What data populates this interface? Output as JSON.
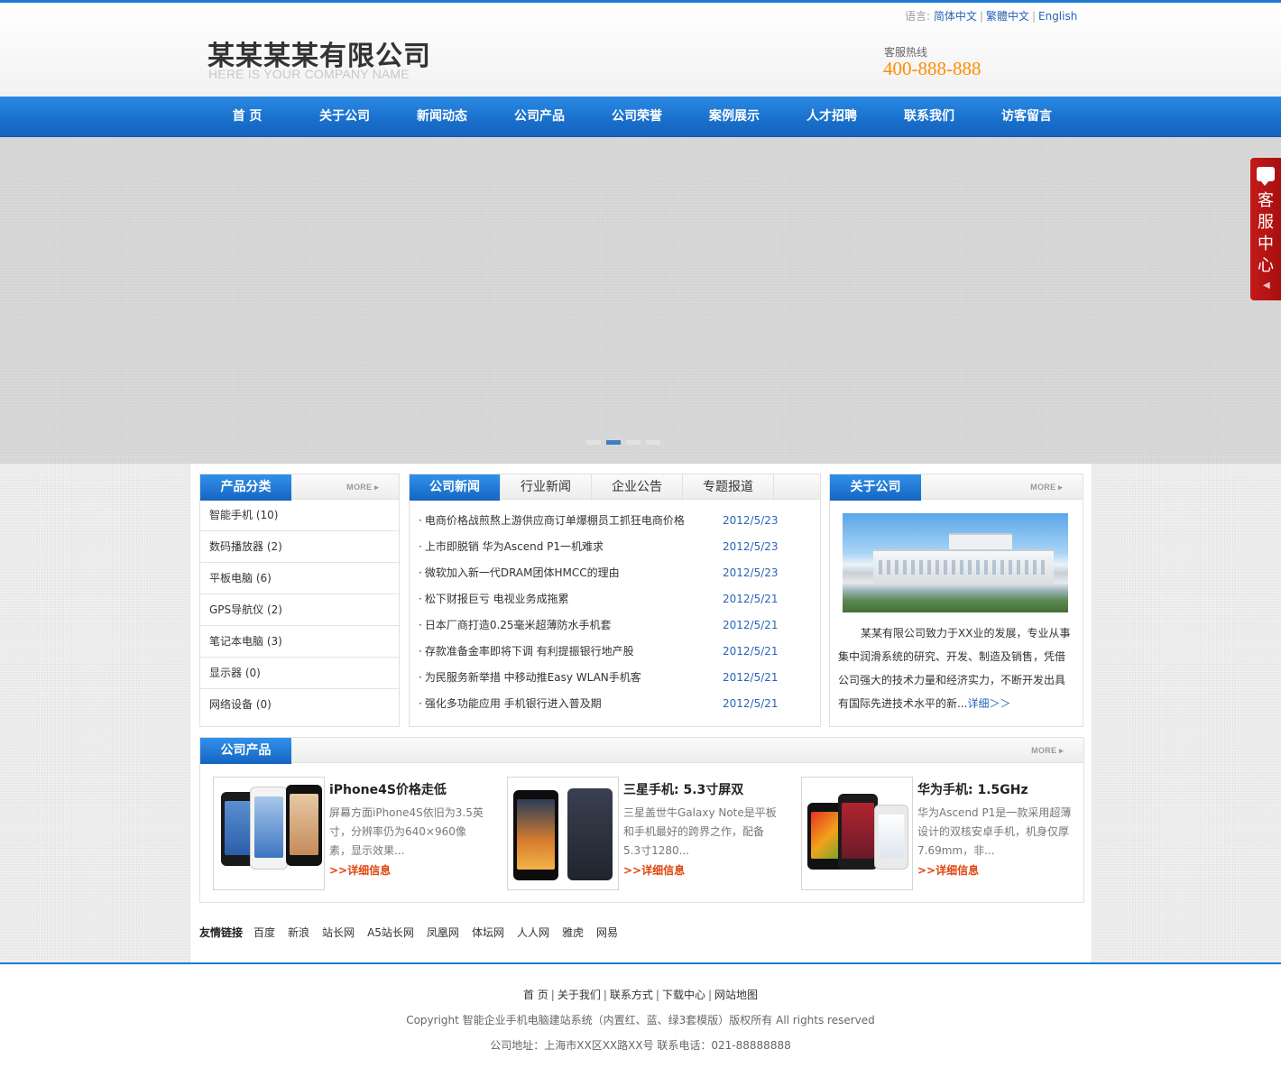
{
  "header": {
    "company_cn": "某某某某有限公司",
    "company_en": "HERE IS YOUR COMPANY NAME",
    "lang_label": "语言:",
    "languages": [
      "简体中文",
      "繁體中文",
      "English"
    ],
    "hotline_label": "客服热线",
    "hotline_number": "400-888-888"
  },
  "nav": [
    "首 页",
    "关于公司",
    "新闻动态",
    "公司产品",
    "公司荣誉",
    "案例展示",
    "人才招聘",
    "联系我们",
    "访客留言"
  ],
  "banner": {
    "slide_count": 4,
    "active_index": 1
  },
  "service_tab": {
    "text": "客服中心"
  },
  "categories": {
    "title": "产品分类",
    "more": "MORE",
    "items": [
      "智能手机 (10)",
      "数码播放器 (2)",
      "平板电脑 (6)",
      "GPS导航仪 (2)",
      "笔记本电脑 (3)",
      "显示器 (0)",
      "网络设备 (0)"
    ]
  },
  "news": {
    "tabs": [
      "公司新闻",
      "行业新闻",
      "企业公告",
      "专题报道"
    ],
    "bullet": "·",
    "items": [
      {
        "title": "电商价格战煎熬上游供应商订单爆棚员工抓狂电商价格",
        "date": "2012/5/23"
      },
      {
        "title": "上市即脱销 华为Ascend P1一机难求",
        "date": "2012/5/23"
      },
      {
        "title": "微软加入新一代DRAM团体HMCC的理由",
        "date": "2012/5/23"
      },
      {
        "title": "松下财报巨亏 电视业务成拖累",
        "date": "2012/5/21"
      },
      {
        "title": "日本厂商打造0.25毫米超薄防水手机套",
        "date": "2012/5/21"
      },
      {
        "title": "存款准备金率即将下调 有利提振银行地产股",
        "date": "2012/5/21"
      },
      {
        "title": "为民服务新举措 中移动推Easy WLAN手机客",
        "date": "2012/5/21"
      },
      {
        "title": "强化多功能应用 手机银行进入普及期",
        "date": "2012/5/21"
      }
    ]
  },
  "about": {
    "title": "关于公司",
    "more": "MORE",
    "text": "某某有限公司致力于XX业的发展，专业从事集中润滑系统的研究、开发、制造及销售，凭借公司强大的技术力量和经济实力，不断开发出具有国际先进技术水平的新...",
    "detail_link": "详细＞＞"
  },
  "products": {
    "title": "公司产品",
    "more": "MORE",
    "detail_label": ">>详细信息",
    "items": [
      {
        "name": "iPhone4S价格走低",
        "desc": "屏幕方面iPhone4S依旧为3.5英寸，分辨率仍为640×960像素，显示效果..."
      },
      {
        "name": "三星手机: 5.3寸屏双",
        "desc": "三星盖世牛Galaxy Note是平板和手机最好的跨界之作，配备5.3寸1280..."
      },
      {
        "name": "华为手机: 1.5GHz",
        "desc": "华为Ascend P1是一款采用超薄设计的双核安卓手机，机身仅厚7.69mm，非..."
      }
    ]
  },
  "links": {
    "label": "友情链接",
    "items": [
      "百度",
      "新浪",
      "站长网",
      "A5站长网",
      "凤凰网",
      "体坛网",
      "人人网",
      "雅虎",
      "网易"
    ]
  },
  "footer": {
    "nav": [
      "首 页",
      "关于我们",
      "联系方式",
      "下载中心",
      "网站地图"
    ],
    "separator": "|",
    "copyright": "Copyright 智能企业手机电脑建站系统（内置红、蓝、绿3套模版）版权所有 All rights reserved",
    "address": "公司地址：上海市XX区XX路XX号 联系电话：021-88888888"
  },
  "colors": {
    "brand_blue": "#1c7ad3",
    "hotline_orange": "#ff8b00",
    "detail_red": "#e0440e",
    "service_red": "#c41a1a"
  }
}
